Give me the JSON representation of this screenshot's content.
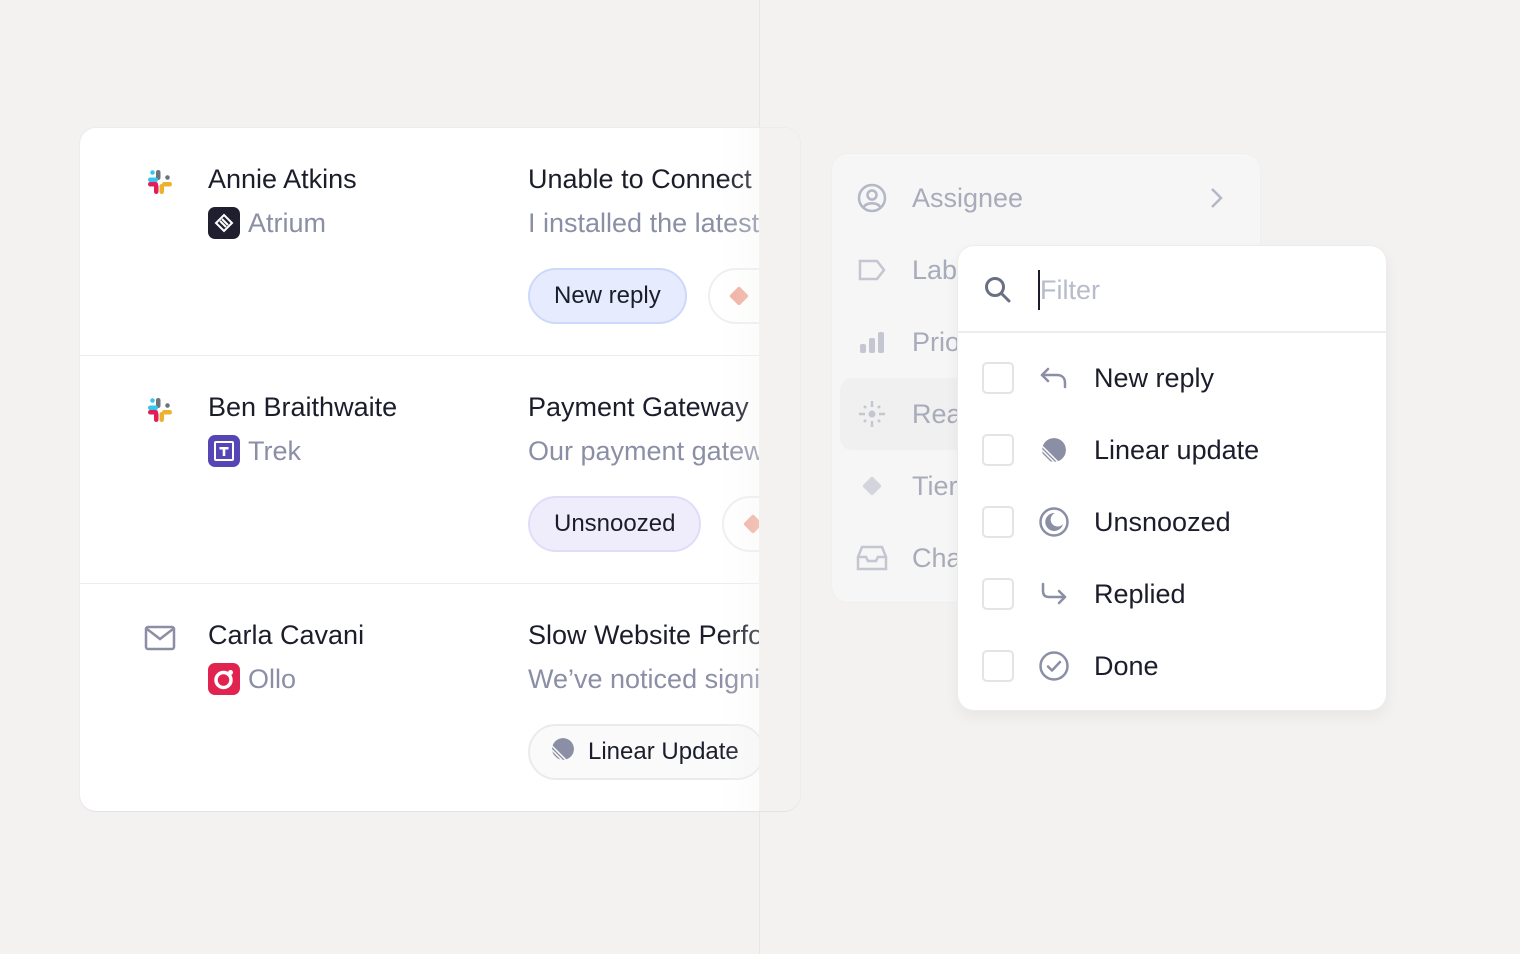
{
  "conversations": [
    {
      "channel": "slack",
      "channel_icon": "slack-icon",
      "name": "Annie Atkins",
      "company": "Atrium",
      "company_logo": "atrium-logo",
      "subject": "Unable to Connect",
      "preview": "I installed the latest",
      "tag": "New reply",
      "tag_style": "blue",
      "secondary_tag_icon": "tier-diamond-icon"
    },
    {
      "channel": "slack",
      "channel_icon": "slack-icon",
      "name": "Ben Braithwaite",
      "company": "Trek",
      "company_logo": "trek-logo",
      "subject": "Payment Gateway",
      "preview": "Our payment gateway",
      "tag": "Unsnoozed",
      "tag_style": "purple",
      "secondary_tag_icon": "tier-diamond-icon"
    },
    {
      "channel": "email",
      "channel_icon": "mail-icon",
      "name": "Carla Cavani",
      "company": "Ollo",
      "company_logo": "ollo-logo",
      "subject": "Slow Website Performance",
      "preview": "We’ve noticed significant",
      "tag": "Linear Update",
      "tag_style": "gray",
      "tag_icon": "linear-icon"
    }
  ],
  "menu": {
    "items": [
      {
        "label": "Assignee",
        "icon": "user-circle-icon",
        "has_submenu": true
      },
      {
        "label": "Labels",
        "icon": "label-tag-icon"
      },
      {
        "label": "Priority",
        "icon": "priority-bars-icon"
      },
      {
        "label": "Reason",
        "icon": "sparkle-icon",
        "hovered": true
      },
      {
        "label": "Tier",
        "icon": "diamond-icon"
      },
      {
        "label": "Channel",
        "icon": "inbox-icon"
      }
    ]
  },
  "filter_popup": {
    "search_placeholder": "Filter",
    "search_value": "",
    "options": [
      {
        "label": "New reply",
        "icon": "reply-arrow-icon",
        "checked": false
      },
      {
        "label": "Linear update",
        "icon": "linear-icon",
        "checked": false
      },
      {
        "label": "Unsnoozed",
        "icon": "moon-icon",
        "checked": false
      },
      {
        "label": "Replied",
        "icon": "replied-arrow-icon",
        "checked": false
      },
      {
        "label": "Done",
        "icon": "check-circle-icon",
        "checked": false
      }
    ]
  },
  "colors": {
    "background": "#f3f2f1",
    "text_primary": "#1b1d2b",
    "text_secondary": "#8b8fa5",
    "tag_blue_bg": "#e6ecfd",
    "tag_purple_bg": "#efedfc",
    "icon_gray": "#8b8fa5"
  }
}
